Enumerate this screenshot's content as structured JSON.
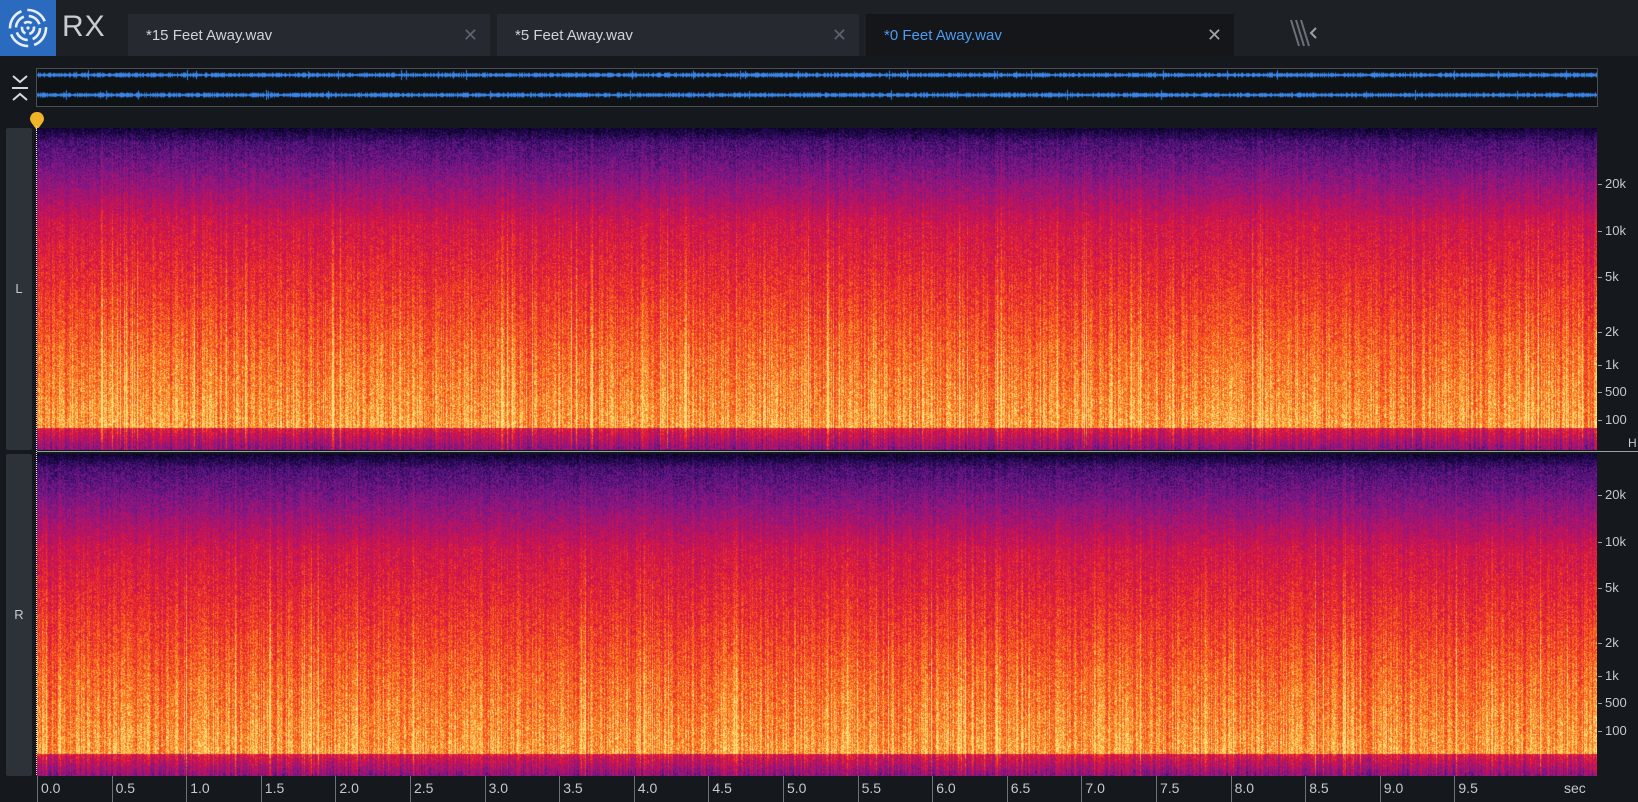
{
  "app": {
    "name": "RX"
  },
  "tabs": [
    {
      "label": "*15 Feet Away.wav",
      "active": false
    },
    {
      "label": "*5 Feet Away.wav",
      "active": false
    },
    {
      "label": "*0 Feet Away.wav",
      "active": true
    }
  ],
  "channels": {
    "left": "L",
    "right": "R"
  },
  "freq_axis": {
    "ticks": [
      "20k",
      "10k",
      "5k",
      "2k",
      "1k",
      "500",
      "100"
    ],
    "unit": "H"
  },
  "time_axis": {
    "ticks": [
      "0.0",
      "0.5",
      "1.0",
      "1.5",
      "2.0",
      "2.5",
      "3.0",
      "3.5",
      "4.0",
      "4.5",
      "5.0",
      "5.5",
      "6.0",
      "6.5",
      "7.0",
      "7.5",
      "8.0",
      "8.5",
      "9.0",
      "9.5"
    ],
    "unit": "sec"
  },
  "colors": {
    "accent": "#2a6bc0",
    "active_tab_text": "#4d9cf0",
    "waveform": "#3a86e8",
    "playhead": "#f0b429"
  },
  "icons": {
    "logo": "rx-spiral-logo",
    "overview_toggle": "collapse-chevrons-icon",
    "tab_overflow": "tab-overflow-icon",
    "close": "close-icon",
    "playhead": "playhead-marker-icon"
  }
}
